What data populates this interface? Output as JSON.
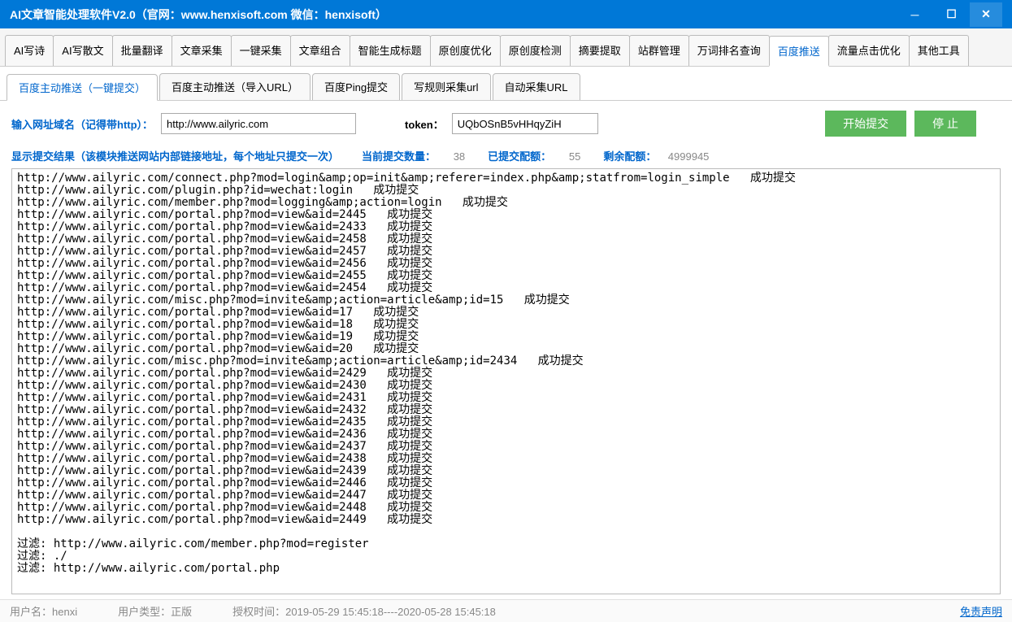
{
  "titlebar": {
    "title": "AI文章智能处理软件V2.0（官网：www.henxisoft.com  微信：henxisoft）"
  },
  "mainTabs": [
    {
      "label": "AI写诗"
    },
    {
      "label": "AI写散文"
    },
    {
      "label": "批量翻译"
    },
    {
      "label": "文章采集"
    },
    {
      "label": "一键采集"
    },
    {
      "label": "文章组合"
    },
    {
      "label": "智能生成标题"
    },
    {
      "label": "原创度优化"
    },
    {
      "label": "原创度检测"
    },
    {
      "label": "摘要提取"
    },
    {
      "label": "站群管理"
    },
    {
      "label": "万词排名查询"
    },
    {
      "label": "百度推送",
      "active": true
    },
    {
      "label": "流量点击优化"
    },
    {
      "label": "其他工具"
    }
  ],
  "subTabs": [
    {
      "label": "百度主动推送（一键提交）",
      "active": true
    },
    {
      "label": "百度主动推送（导入URL）"
    },
    {
      "label": "百度Ping提交"
    },
    {
      "label": "写规则采集url"
    },
    {
      "label": "自动采集URL"
    }
  ],
  "form": {
    "urlLabel": "输入网址域名（记得带http）：",
    "urlValue": "http://www.ailyric.com",
    "tokenLabel": "token：",
    "tokenValue": "UQbOSnB5vHHqyZiH",
    "startBtn": "开始提交",
    "stopBtn": "停  止"
  },
  "stats": {
    "resultLabel": "显示提交结果（该模块推送网站内部链接地址，每个地址只提交一次）",
    "currentLabel": "当前提交数量：",
    "currentVal": "38",
    "submittedLabel": "已提交配额：",
    "submittedVal": "55",
    "remainLabel": "剩余配额：",
    "remainVal": "4999945"
  },
  "log": "http://www.ailyric.com/connect.php?mod=login&amp;op=init&amp;referer=index.php&amp;statfrom=login_simple   成功提交\nhttp://www.ailyric.com/plugin.php?id=wechat:login   成功提交\nhttp://www.ailyric.com/member.php?mod=logging&amp;action=login   成功提交\nhttp://www.ailyric.com/portal.php?mod=view&aid=2445   成功提交\nhttp://www.ailyric.com/portal.php?mod=view&aid=2433   成功提交\nhttp://www.ailyric.com/portal.php?mod=view&aid=2458   成功提交\nhttp://www.ailyric.com/portal.php?mod=view&aid=2457   成功提交\nhttp://www.ailyric.com/portal.php?mod=view&aid=2456   成功提交\nhttp://www.ailyric.com/portal.php?mod=view&aid=2455   成功提交\nhttp://www.ailyric.com/portal.php?mod=view&aid=2454   成功提交\nhttp://www.ailyric.com/misc.php?mod=invite&amp;action=article&amp;id=15   成功提交\nhttp://www.ailyric.com/portal.php?mod=view&aid=17   成功提交\nhttp://www.ailyric.com/portal.php?mod=view&aid=18   成功提交\nhttp://www.ailyric.com/portal.php?mod=view&aid=19   成功提交\nhttp://www.ailyric.com/portal.php?mod=view&aid=20   成功提交\nhttp://www.ailyric.com/misc.php?mod=invite&amp;action=article&amp;id=2434   成功提交\nhttp://www.ailyric.com/portal.php?mod=view&aid=2429   成功提交\nhttp://www.ailyric.com/portal.php?mod=view&aid=2430   成功提交\nhttp://www.ailyric.com/portal.php?mod=view&aid=2431   成功提交\nhttp://www.ailyric.com/portal.php?mod=view&aid=2432   成功提交\nhttp://www.ailyric.com/portal.php?mod=view&aid=2435   成功提交\nhttp://www.ailyric.com/portal.php?mod=view&aid=2436   成功提交\nhttp://www.ailyric.com/portal.php?mod=view&aid=2437   成功提交\nhttp://www.ailyric.com/portal.php?mod=view&aid=2438   成功提交\nhttp://www.ailyric.com/portal.php?mod=view&aid=2439   成功提交\nhttp://www.ailyric.com/portal.php?mod=view&aid=2446   成功提交\nhttp://www.ailyric.com/portal.php?mod=view&aid=2447   成功提交\nhttp://www.ailyric.com/portal.php?mod=view&aid=2448   成功提交\nhttp://www.ailyric.com/portal.php?mod=view&aid=2449   成功提交\n\n过滤: http://www.ailyric.com/member.php?mod=register\n过滤: ./\n过滤: http://www.ailyric.com/portal.php",
  "status": {
    "userLabel": "用户名：",
    "userVal": "henxi",
    "typeLabel": "用户类型：",
    "typeVal": "正版",
    "authLabel": "授权时间：",
    "authVal": "2019-05-29 15:45:18----2020-05-28 15:45:18",
    "disclaimer": "免责声明"
  }
}
